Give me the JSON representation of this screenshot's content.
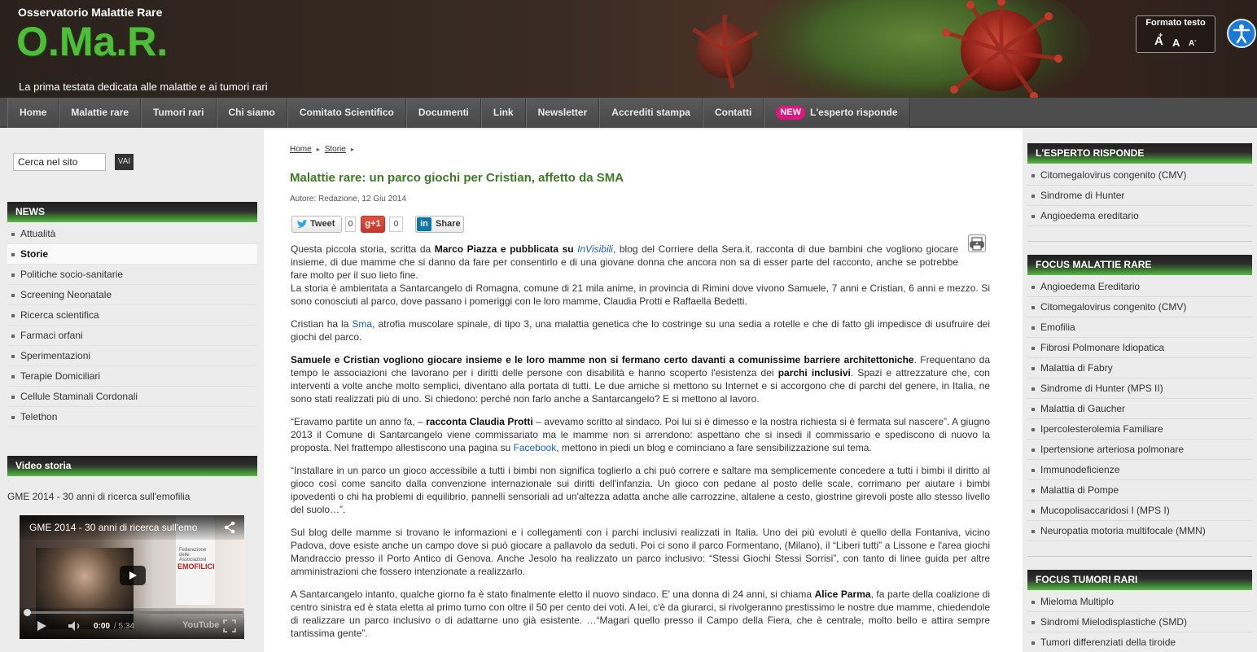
{
  "header": {
    "site_name": "Osservatorio Malattie Rare",
    "logo": "O.Ma.R.",
    "tagline": "La prima testata dedicata alle malattie e ai tumori rari",
    "text_format": {
      "title": "Formato testo",
      "larger": "A",
      "normal": "A",
      "smaller": "A"
    },
    "accessibility_icon": "accessibility-icon"
  },
  "nav": {
    "items": [
      "Home",
      "Malattie rare",
      "Tumori rari",
      "Chi siamo",
      "Comitato Scientifico",
      "Documenti",
      "Link",
      "Newsletter",
      "Accrediti stampa",
      "Contatti"
    ],
    "new_badge": "NEW",
    "expert": "L'esperto risponde"
  },
  "search": {
    "value": "Cerca nel sito",
    "button": "VAI"
  },
  "left": {
    "news_title": "NEWS",
    "news_items": [
      "Attualità",
      "Storie",
      "Politiche socio-sanitarie",
      "Screening Neonatale",
      "Ricerca scientifica",
      "Farmaci orfani",
      "Sperimentazioni",
      "Terapie Domiciliari",
      "Cellule Staminali Cordonali",
      "Telethon"
    ],
    "active_item": "Storie",
    "video_title": "Video storia",
    "video_caption": "GME 2014 - 30 anni di ricerca sull'emofilia",
    "video": {
      "title": "GME 2014 -  30 anni di ricerca sull'emo",
      "time_current": "0:00",
      "time_total": "/ 5:34",
      "brand": "YouTube",
      "banner_top": "Federazione delle Associazioni",
      "banner_big": "EMOFILICI",
      "progress": 0
    }
  },
  "article": {
    "breadcrumb": [
      "Home",
      "Storie"
    ],
    "title": "Malattie rare: un parco giochi per Cristian, affetto da SMA",
    "meta": "Autore: Redazione,  12 Giu 2014",
    "share": {
      "tweet": "Tweet",
      "tweet_count": "0",
      "gplus": "+1",
      "gplus_count": "0",
      "linkedin": "Share"
    },
    "p1a": "Questa piccola storia, scritta da ",
    "p1b": "Marco Piazza e pubblicata su ",
    "p1link": "InVisibili",
    "p1c": ", blog del Corriere della Sera.it, racconta di due bambini che vogliono giocare insieme, di due mamme che si danno da fare per consentirlo e di una giovane donna che ancora non sa di esser parte del racconto, anche se potrebbe fare molto per il suo lieto fine.",
    "p1d": "La storia è ambientata a Santarcangelo di Romagna, comune di 21 mila anime, in provincia di Rimini dove vivono Samuele, 7 anni e Cristian, 6 anni e mezzo. Si sono conosciuti al parco, dove passano i pomeriggi con le loro mamme, Claudia Protti e Raffaella Bedetti.",
    "p2a": "Cristian ha la ",
    "p2link": "Sma",
    "p2b": ", atrofia muscolare spinale, di tipo 3, una malattia genetica che lo costringe su una sedia a rotelle e che di fatto gli impedisce di usufruire dei giochi del parco.",
    "p3a": "Samuele e Cristian vogliono giocare insieme e le loro mamme non si fermano certo davanti a comunissime barriere architettoniche",
    "p3b": ". Frequentano da tempo le associazioni che lavorano per i diritti delle persone con disabilità e hanno scoperto l'esistenza dei ",
    "p3c": "parchi inclusivi",
    "p3d": ". Spazi e attrezzature che, con interventi a volte anche molto semplici, diventano alla portata di tutti. Le due amiche si mettono su Internet e si accorgono che di parchi del genere, in Italia, ne sono stati realizzati più di uno. Si chiedono: perché non farlo anche a Santarcangelo? E si mettono al lavoro.",
    "p4a": "“Eravamo partite un anno fa, – ",
    "p4b": "racconta Claudia Protti",
    "p4c": " – avevamo scritto al sindaco. Poi lui si è dimesso e la nostra richiesta si è fermata sul nascere”. A giugno 2013 il Comune di Santarcangelo viene commissariato ma le mamme non si arrendono: aspettano che si insedi il commissario e spediscono di nuovo la proposta. Nel frattempo allestiscono una pagina su ",
    "p4link": "Facebook",
    "p4d": ", mettono in piedi un blog e cominciano a fare sensibilizzazione sul tema.",
    "p5": "“Installare in un parco un gioco accessibile a tutti i bimbi non significa toglierlo a chi può correre e saltare ma semplicemente concedere a tutti i bimbi il diritto al gioco così come sancito dalla convenzione internazionale sui diritti dell'infanzia. Un gioco con pedane al posto delle scale, corrimano per aiutare i bimbi ipovedenti o chi ha problemi di equilibrio, pannelli sensoriali ad un'altezza adatta anche alle carrozzine, altalene a cesto, giostrine girevoli poste allo stesso livello del suolo…”.",
    "p6": "Sul blog delle mamme si trovano le informazioni e i collegamenti con i parchi inclusivi realizzati in Italia. Uno dei più evoluti è quello della Fontaniva, vicino Padova, dove esiste anche un campo dove si può giocare a pallavolo da seduti. Poi ci sono il parco Formentano, (Milano), il “Liberi tutti” a Lissone e l'area giochi Mandraccio presso il Porto Antico di Genova. Anche Jesolo ha realizzato un parco inclusivo: “Stessi Giochi Stessi Sorrisi”, con tanto di linee guida per altre amministrazioni che fossero intenzionate a realizzarlo.",
    "p7a": "A Santarcangelo intanto, qualche giorno fa è stato finalmente eletto il nuovo sindaco. E' una donna di 24 anni, si chiama ",
    "p7b": "Alice Parma",
    "p7c": ", fa parte della coalizione di centro sinistra ed è stata eletta al primo turno con oltre il 50 per cento dei voti. A lei, c'è da giurarci, si rivolgeranno prestissimo le nostre due mamme, chiedendole di realizzare un parco inclusivo o di adattarne uno già esistente. …“Magari quello presso il Campo della Fiera, che è centrale, molto bello e attira sempre tantissima gente”."
  },
  "right": {
    "expert_title": "L'ESPERTO RISPONDE",
    "expert_items": [
      "Citomegalovirus congenito (CMV)",
      "Sindrome di Hunter",
      "Angioedema ereditario"
    ],
    "focus_rare_title": "FOCUS MALATTIE RARE",
    "focus_rare_items": [
      "Angioedema Ereditario",
      "Citomegalovirus congenito (CMV)",
      "Emofilia",
      "Fibrosi Polmonare Idiopatica",
      "Malattia di Fabry",
      "Sindrome di Hunter (MPS II)",
      "Malattia di Gaucher",
      "Ipercolesterolemia Familiare",
      "Ipertensione arteriosa polmonare",
      "Immunodeficienze",
      "Malattia di Pompe",
      "Mucopolisaccaridosi I (MPS I)",
      "Neuropatia motoria multifocale (MMN)"
    ],
    "focus_tumors_title": "FOCUS TUMORI RARI",
    "focus_tumors_items": [
      "Mieloma Multiplo",
      "Sindromi Mielodisplastiche (SMD)",
      "Tumori differenziati della tiroide"
    ]
  }
}
